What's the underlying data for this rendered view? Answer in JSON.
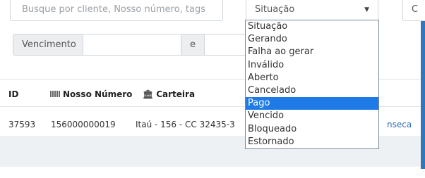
{
  "filters": {
    "search_placeholder": "Busque por cliente, Nosso número, tags",
    "status_select": "Situação",
    "partial_field": "C",
    "due_label": "Vencimento",
    "and_label": "e"
  },
  "dropdown": {
    "options": [
      "Situação",
      "Gerando",
      "Falha ao gerar",
      "Inválido",
      "Aberto",
      "Cancelado",
      "Pago",
      "Vencido",
      "Bloqueado",
      "Estornado"
    ],
    "selected": "Pago"
  },
  "table": {
    "headers": {
      "id": "ID",
      "nosso": "Nosso Número",
      "carteira": "Carteira"
    },
    "rows": [
      {
        "id": "37593",
        "nosso": "156000000019",
        "carteira": "Itaú - 156 - CC 32435-3",
        "client_partial": "nseca"
      }
    ]
  },
  "colors": {
    "accent": "#2f78c0",
    "selected": "#1e7ae6",
    "link": "#2a6fb0"
  }
}
